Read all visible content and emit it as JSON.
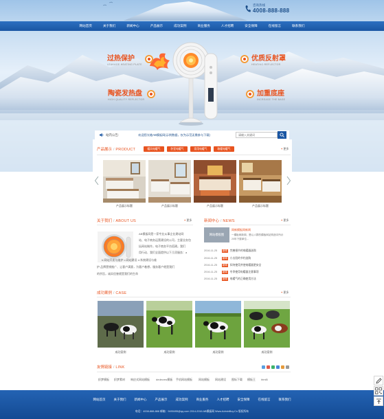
{
  "header": {
    "hotline_label": "咨询热线",
    "hotline_number": "4008-888-888"
  },
  "nav": [
    "网站首页",
    "关于我们",
    "新闻中心",
    "产品展示",
    "成功案例",
    "商业服务",
    "人才招聘",
    "安全保障",
    "在线留言",
    "联系我们"
  ],
  "hero": {
    "features": [
      {
        "cn": "过热保护",
        "en": "LEAKAGE HEATING PLATE"
      },
      {
        "cn": "优质反射罩",
        "en": "HEATING REFLECTOR"
      },
      {
        "cn": "陶瓷发热盘",
        "en": "HIGH QUALITY REFLECTOR"
      },
      {
        "cn": "加重底座",
        "en": "INCREASE THE BASE"
      }
    ]
  },
  "notice": {
    "label": "站内公告:",
    "text": "欢迎您光临AB模板网(示例数据，仅为示范无需参与下载)",
    "search_placeholder": "请输入关键词"
  },
  "product": {
    "title": "产品展示",
    "title_en": "PRODUCT",
    "more": "更多",
    "tags": [
      "暖风电暖气",
      "卧室电暖气",
      "家用电暖气",
      "取暖电暖气"
    ],
    "items": [
      "产品展示标题",
      "产品展示标题",
      "产品展示标题",
      "产品展示标题"
    ]
  },
  "about": {
    "title": "关于我们",
    "title_en": "ABOUT US",
    "more": "更多",
    "lines": [
      "AB模板网是一家专业从事企业建站网",
      "站、电子商务运营建设的公司，主要业务包",
      "括网站制作，电子商务平台搭建。我们",
      "用行动、我们全面提供以下几项服务：a",
      "b.网站开发与维护 c.网站建设 d.系统建设与维",
      "护.品牌营销推广、让客户满意，为客户着想，服务客户就是我们",
      "的宗旨，诚实信誉就是我们的生命"
    ]
  },
  "news": {
    "title": "新闻中心",
    "title_en": "NEWS",
    "more": "更多",
    "thumb_text": "网站模板图",
    "featured_title": "网新模板网新闻",
    "featured_summary": [
      "一模板网新闻，是以人群的模板网站构造中所示",
      "20年下属单位..."
    ],
    "items": [
      {
        "date": "2016-11-25",
        "title": "完善细节的电暖器选购"
      },
      {
        "date": "2016-11-25",
        "title": "小太阳的节约选购"
      },
      {
        "date": "2016-11-25",
        "title": "如何使用并使电暖器更安全"
      },
      {
        "date": "2016-11-25",
        "title": "冬季使用电暖器注意事项"
      },
      {
        "date": "2016-11-25",
        "title": "电暖气的正确使用方法"
      },
      {
        "date": "2016-11-25",
        "title": "家庭取暖如何挑选电暖器"
      }
    ]
  },
  "cases": {
    "title": "成功案例",
    "title_en": "CASE",
    "more": "更多",
    "items": [
      "成功案例",
      "成功案例",
      "成功案例",
      "成功案例"
    ]
  },
  "links": {
    "title": "友情链接",
    "title_en": "LINK",
    "items": [
      "织梦模板",
      "织梦素材",
      "响应式网站模板",
      "dedecms模板",
      "手机网站模板",
      "网站模板",
      "网站建设",
      "图标下载",
      "模板王",
      "html5"
    ]
  },
  "footer": {
    "nav": [
      "网站首页",
      "关于我们",
      "新闻中心",
      "产品展示",
      "成功案例",
      "商业服务",
      "人才招聘",
      "安全保障",
      "在线留言",
      "联系我们"
    ],
    "copyright": "电话：4008-888-888  邮箱：9490495@qq.com  2014-2016 AB模板网 Www.AdminBuy.Cn 版权所有"
  },
  "colors": {
    "brand_blue": "#1a56a3",
    "accent_orange": "#e8531f"
  }
}
